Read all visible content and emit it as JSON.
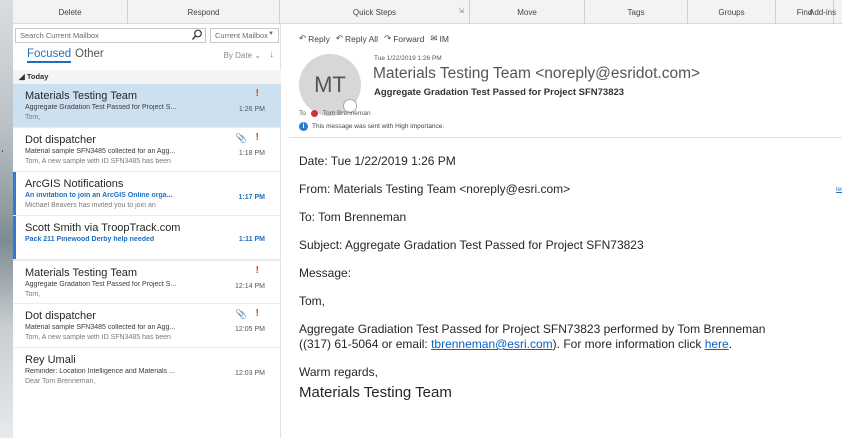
{
  "ribbon": {
    "groups": [
      "Delete",
      "Respond",
      "Quick Steps",
      "Move",
      "Tags",
      "Groups",
      "Find",
      "Add-ins"
    ]
  },
  "search": {
    "placeholder": "Search Current Mailbox",
    "scope": "Current Mailbox"
  },
  "tabs": {
    "focused": "Focused",
    "other": "Other",
    "sort": "By Date"
  },
  "group": {
    "label": "Today"
  },
  "mails": [
    {
      "sender": "Materials Testing Team",
      "subject": "Aggregate Gradation Test Passed for Project S...",
      "preview": "Tom,",
      "time": "1:26 PM",
      "important": "!"
    },
    {
      "sender": "Dot dispatcher",
      "subject": "Material sample SFN3485 collected for an Agg...",
      "preview": "Tom,  A new sample with ID SFN3485 has been",
      "time": "1:18 PM",
      "important": "!"
    },
    {
      "sender": "ArcGIS Notifications",
      "subject": "An invitation to join an ArcGIS Online orga...",
      "preview": "Michael Beavers has invited you to join an",
      "time": "1:17 PM"
    },
    {
      "sender": "Scott Smith via TroopTrack.com",
      "subject": "Pack 211 Pinewood Derby help needed",
      "preview": "",
      "time": "1:11 PM"
    },
    {
      "sender": "Materials Testing Team",
      "subject": "Aggregate Gradation Test Passed for Project S...",
      "preview": "Tom,",
      "time": "12:14 PM",
      "important": "!"
    },
    {
      "sender": "Dot dispatcher",
      "subject": "Material sample SFN3485 collected for an Agg...",
      "preview": "Tom,  A new sample with ID SFN3485 has been",
      "time": "12:05 PM",
      "important": "!"
    },
    {
      "sender": "Rey Umali",
      "subject": "Reminder: Location Intelligence and Materials ...",
      "preview": "Dear Tom Brenneman,",
      "time": "12:03 PM"
    }
  ],
  "reading": {
    "actions": [
      "Reply",
      "Reply All",
      "Forward",
      "IM"
    ],
    "avatar_initials": "MT",
    "date": "Tue 1/22/2019 1:26 PM",
    "from": "Materials Testing Team <noreply@esridot.com>",
    "subject": "Aggregate Gradation Test Passed for Project SFN73823",
    "to_label": "To",
    "to": "Tom Brenneman",
    "importance": "This message was sent with High importance.",
    "side_link": "les",
    "body": {
      "date": "Date: Tue 1/22/2019 1:26 PM",
      "from": "From: Materials Testing Team <noreply@esri.com>",
      "to": "To: Tom Brenneman",
      "subject": "Subject: Aggregate Gradation Test Passed for Project SFN73823",
      "message_label": "Message:",
      "greeting": "Tom,",
      "para1": "Aggregate Gradiation Test Passed for Project SFN73823 performed by Tom Brenneman",
      "para2_pre": "((317) 61-5064 or email: ",
      "para2_email": "tbrenneman@esri.com",
      "para2_mid": "). For more information click ",
      "para2_link": "here",
      "para2_post": ".",
      "closing": "Warm regards,",
      "signature": "Materials Testing Team"
    }
  },
  "colors": {
    "accent": "#1f6fbf",
    "selected": "#cde0f0",
    "flag": "#d04a02",
    "link": "#0563c1"
  }
}
